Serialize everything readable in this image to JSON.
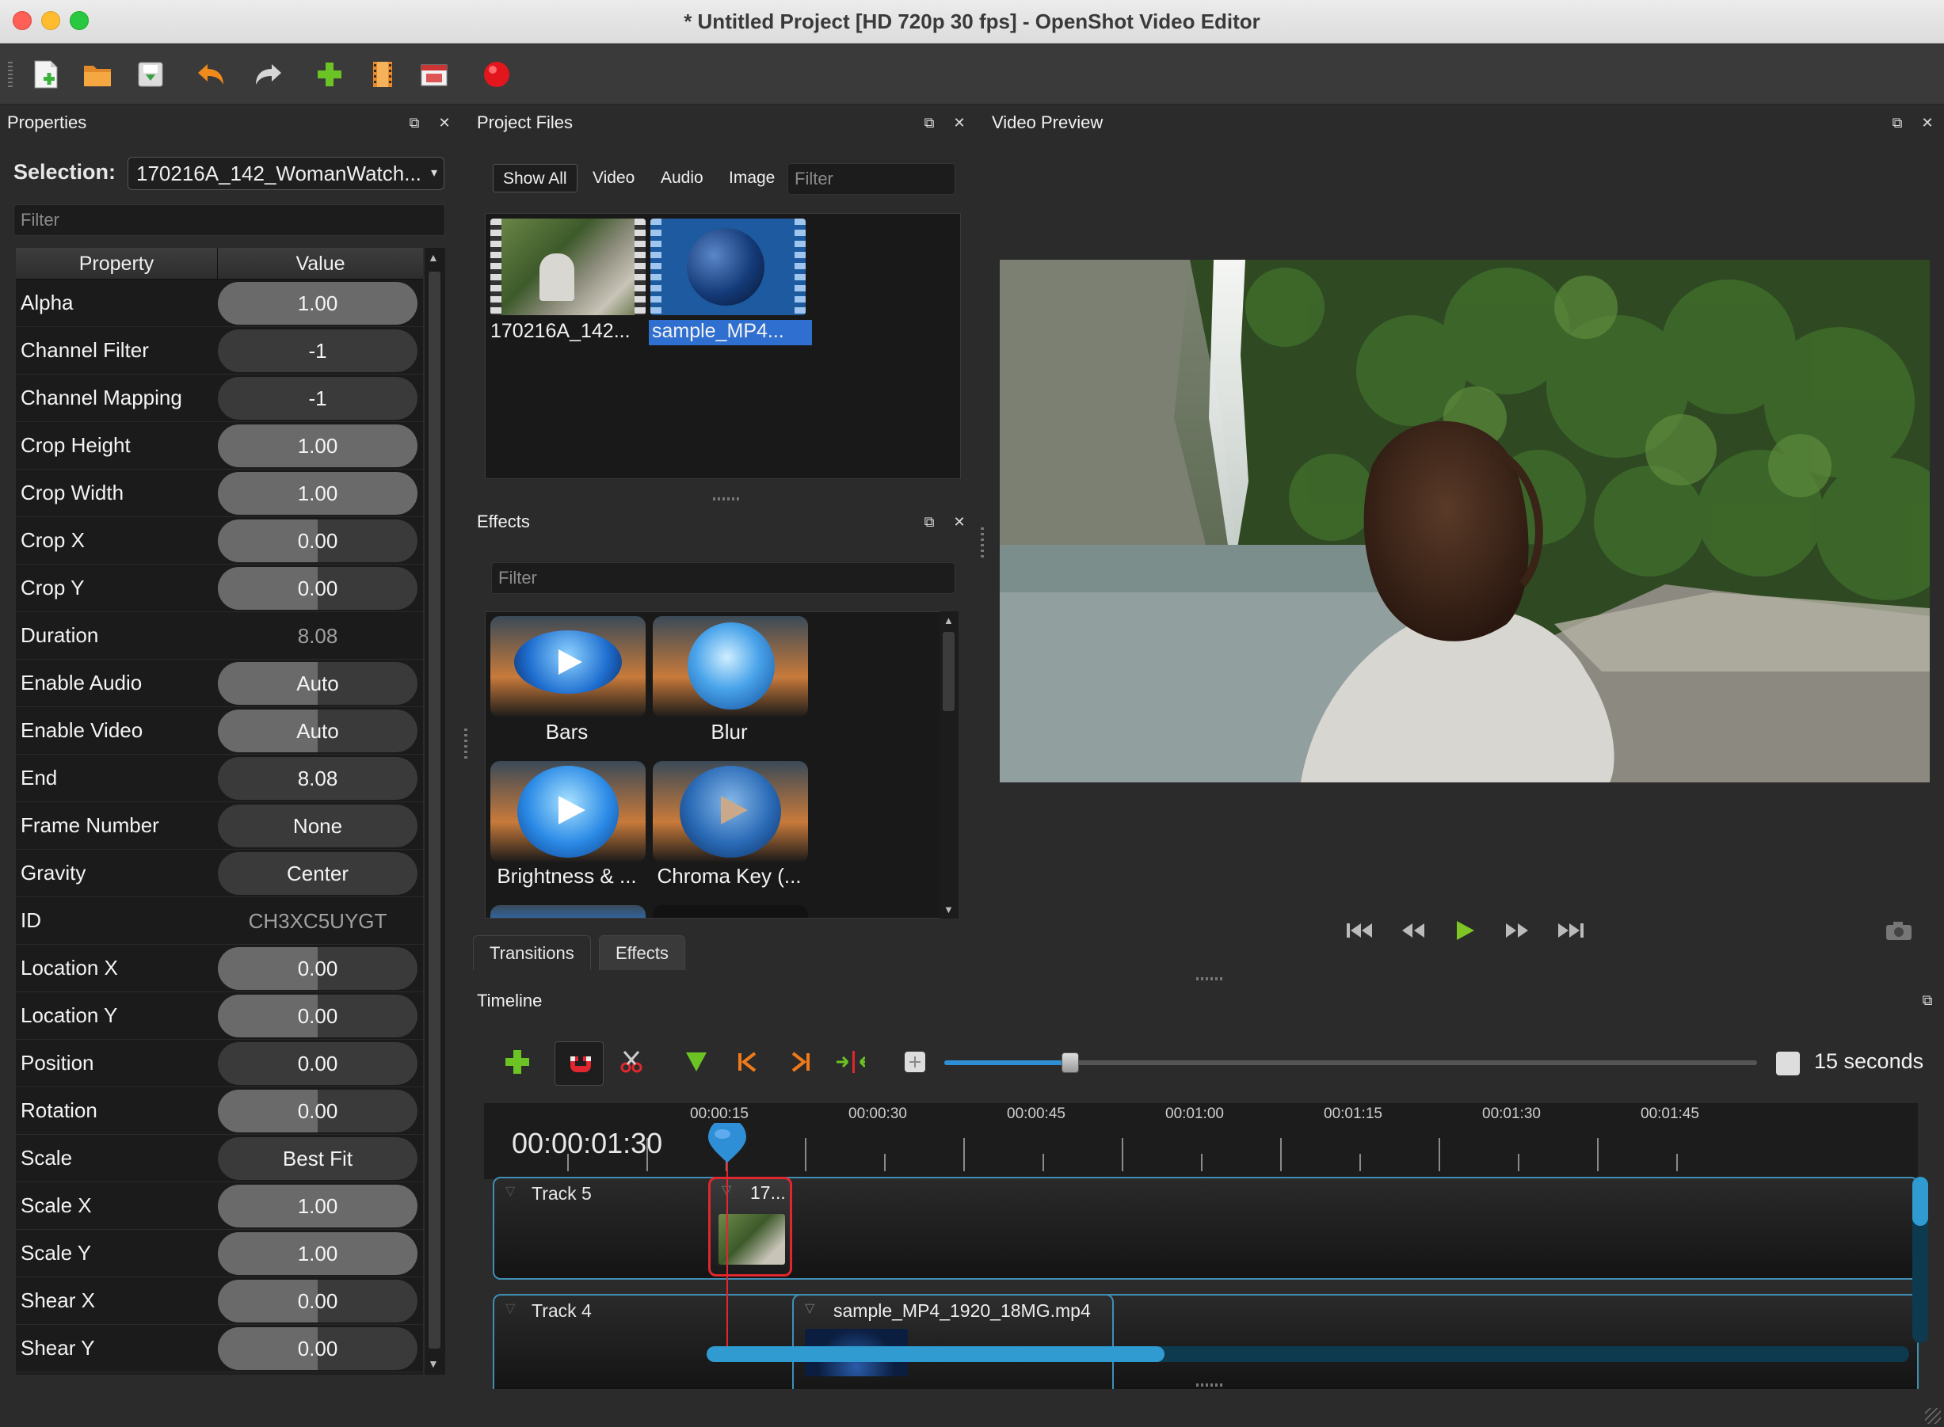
{
  "window": {
    "title": "* Untitled Project [HD 720p 30 fps] - OpenShot Video Editor"
  },
  "toolbar": {
    "icons": [
      "new-project-icon",
      "open-project-icon",
      "save-project-icon",
      "undo-icon",
      "redo-icon",
      "import-files-icon",
      "choose-profile-icon",
      "export-video-icon",
      "record-icon"
    ]
  },
  "properties": {
    "header": "Properties",
    "selection_label": "Selection:",
    "selection_value": "170216A_142_WomanWatch...",
    "filter_placeholder": "Filter",
    "col_property": "Property",
    "col_value": "Value",
    "rows": [
      {
        "name": "Alpha",
        "value": "1.00",
        "fill": 1.0
      },
      {
        "name": "Channel Filter",
        "value": "-1",
        "fill": 0
      },
      {
        "name": "Channel Mapping",
        "value": "-1",
        "fill": 0
      },
      {
        "name": "Crop Height",
        "value": "1.00",
        "fill": 1.0
      },
      {
        "name": "Crop Width",
        "value": "1.00",
        "fill": 1.0
      },
      {
        "name": "Crop X",
        "value": "0.00",
        "fill": 0.5
      },
      {
        "name": "Crop Y",
        "value": "0.00",
        "fill": 0.5
      },
      {
        "name": "Duration",
        "value": "8.08",
        "fill": 0,
        "readonly": true
      },
      {
        "name": "Enable Audio",
        "value": "Auto",
        "fill": 0.5
      },
      {
        "name": "Enable Video",
        "value": "Auto",
        "fill": 0.5
      },
      {
        "name": "End",
        "value": "8.08",
        "fill": 0
      },
      {
        "name": "Frame Number",
        "value": "None",
        "fill": 0
      },
      {
        "name": "Gravity",
        "value": "Center",
        "fill": 0
      },
      {
        "name": "ID",
        "value": "CH3XC5UYGT",
        "fill": 0,
        "readonly": true
      },
      {
        "name": "Location X",
        "value": "0.00",
        "fill": 0.5
      },
      {
        "name": "Location Y",
        "value": "0.00",
        "fill": 0.5
      },
      {
        "name": "Position",
        "value": "0.00",
        "fill": 0
      },
      {
        "name": "Rotation",
        "value": "0.00",
        "fill": 0.5
      },
      {
        "name": "Scale",
        "value": "Best Fit",
        "fill": 0
      },
      {
        "name": "Scale X",
        "value": "1.00",
        "fill": 1.0
      },
      {
        "name": "Scale Y",
        "value": "1.00",
        "fill": 1.0
      },
      {
        "name": "Shear X",
        "value": "0.00",
        "fill": 0.5
      },
      {
        "name": "Shear Y",
        "value": "0.00",
        "fill": 0.5
      }
    ]
  },
  "project_files": {
    "header": "Project Files",
    "tabs": [
      "Show All",
      "Video",
      "Audio",
      "Image"
    ],
    "filter_placeholder": "Filter",
    "files": [
      {
        "label": "170216A_142...",
        "selected": false
      },
      {
        "label": "sample_MP4...",
        "selected": true
      }
    ]
  },
  "effects": {
    "header": "Effects",
    "filter_placeholder": "Filter",
    "items": [
      "Bars",
      "Blur",
      "Brightness & ...",
      "Chroma Key (..."
    ]
  },
  "bottom_tabs": [
    "Transitions",
    "Effects"
  ],
  "video_preview": {
    "header": "Video Preview"
  },
  "timeline": {
    "header": "Timeline",
    "zoom_label": "15 seconds",
    "zoom_level": 0.15,
    "playhead_time": "00:00:01:30",
    "ruler_labels": [
      "00:00:15",
      "00:00:30",
      "00:00:45",
      "00:01:00",
      "00:01:15",
      "00:01:30",
      "00:01:45"
    ],
    "tracks": [
      {
        "name": "Track 5",
        "clip": "17..."
      },
      {
        "name": "Track 4",
        "clip": "sample_MP4_1920_18MG.mp4"
      }
    ]
  },
  "colors": {
    "accent": "#2f8fd6",
    "track_border": "#3f8fb5",
    "selected_clip": "#e0262e",
    "playhead": "#e0262e"
  }
}
